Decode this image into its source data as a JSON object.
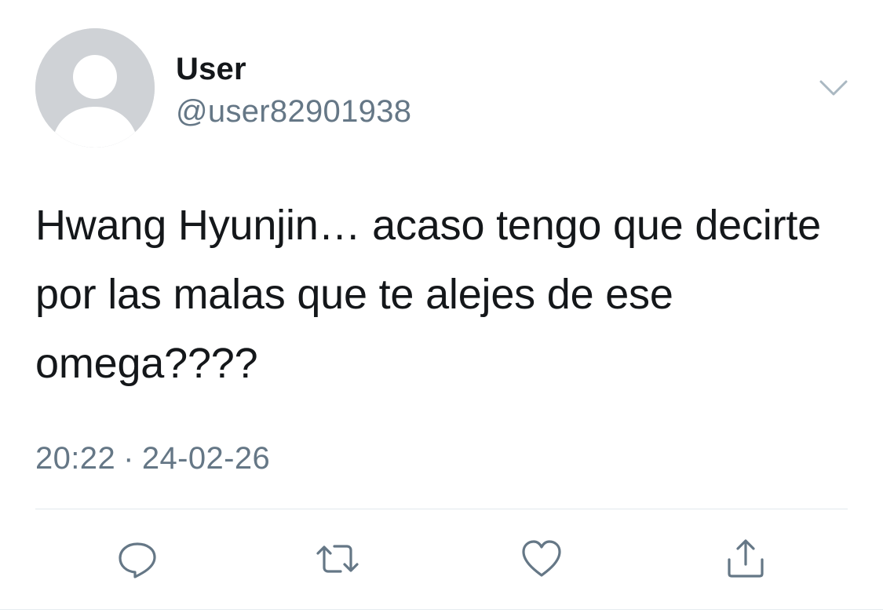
{
  "user": {
    "display_name": "User",
    "handle": "@user82901938"
  },
  "tweet": {
    "text": "Hwang Hyunjin… acaso tengo que decirte por las malas que te alejes de ese omega????",
    "time": "20:22",
    "separator": "·",
    "date": "24-02-26"
  },
  "icons": {
    "more": "chevron-down-icon",
    "reply": "reply-icon",
    "retweet": "retweet-icon",
    "like": "heart-icon",
    "share": "share-icon"
  },
  "colors": {
    "icon_gray": "#657786",
    "secondary_text": "#657786",
    "avatar_bg": "#cfd2d6",
    "divider": "#e1e8ed"
  }
}
